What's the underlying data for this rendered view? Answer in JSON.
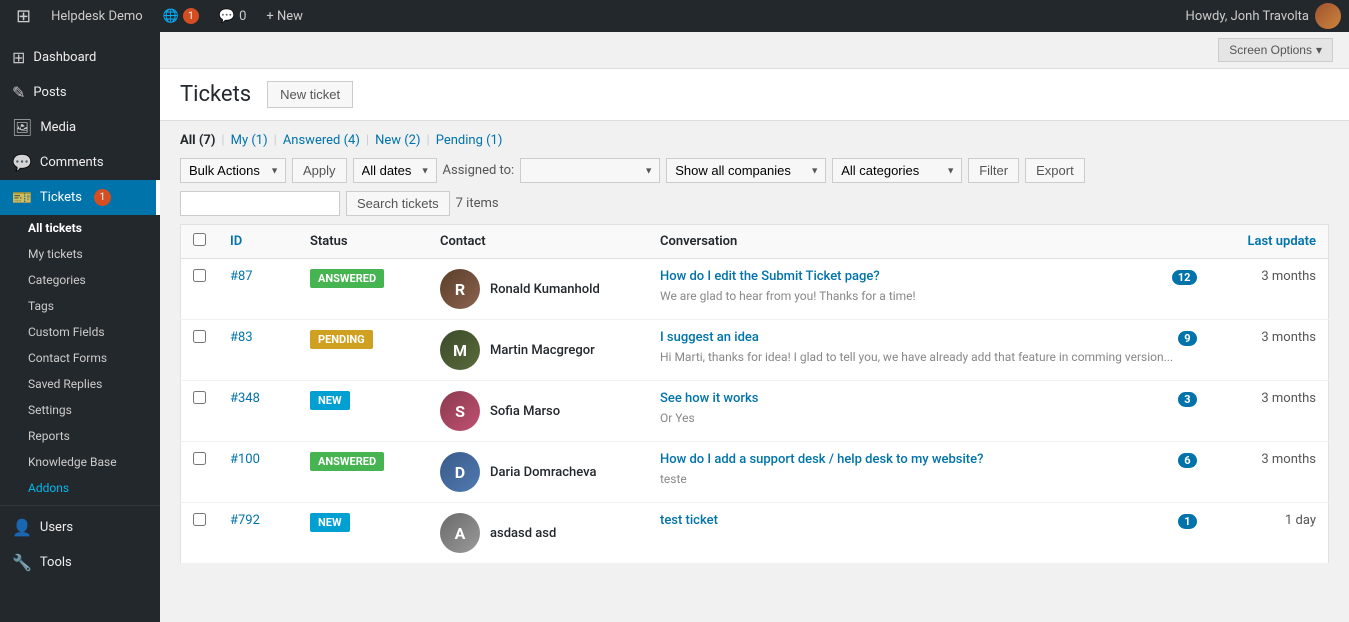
{
  "adminbar": {
    "site_name": "Helpdesk Demo",
    "globe_count": "1",
    "comment_count": "0",
    "new_label": "+ New",
    "user_name": "Howdy, Jonh Travolta",
    "screen_options": "Screen Options"
  },
  "sidebar": {
    "items": [
      {
        "id": "dashboard",
        "label": "Dashboard",
        "icon": "⊞"
      },
      {
        "id": "posts",
        "label": "Posts",
        "icon": "✎"
      },
      {
        "id": "media",
        "label": "Media",
        "icon": "🖼"
      },
      {
        "id": "comments",
        "label": "Comments",
        "icon": "💬"
      },
      {
        "id": "tickets",
        "label": "Tickets",
        "icon": "🎫",
        "badge": "1",
        "active": true
      }
    ],
    "tickets_sub": [
      {
        "id": "all-tickets",
        "label": "All tickets",
        "active": true
      },
      {
        "id": "my-tickets",
        "label": "My tickets"
      },
      {
        "id": "categories",
        "label": "Categories"
      },
      {
        "id": "tags",
        "label": "Tags"
      },
      {
        "id": "custom-fields",
        "label": "Custom Fields"
      },
      {
        "id": "contact-forms",
        "label": "Contact Forms"
      },
      {
        "id": "saved-replies",
        "label": "Saved Replies"
      },
      {
        "id": "settings",
        "label": "Settings"
      },
      {
        "id": "reports",
        "label": "Reports"
      },
      {
        "id": "knowledge-base",
        "label": "Knowledge Base"
      },
      {
        "id": "addons",
        "label": "Addons"
      }
    ],
    "bottom_items": [
      {
        "id": "users",
        "label": "Users",
        "icon": "👤"
      },
      {
        "id": "tools",
        "label": "Tools",
        "icon": "🔧"
      }
    ]
  },
  "page": {
    "title": "Tickets",
    "new_ticket_label": "New ticket"
  },
  "filter_tabs": [
    {
      "id": "all",
      "label": "All",
      "count": "7",
      "active": true
    },
    {
      "id": "my",
      "label": "My",
      "count": "1"
    },
    {
      "id": "answered",
      "label": "Answered",
      "count": "4"
    },
    {
      "id": "new",
      "label": "New",
      "count": "2"
    },
    {
      "id": "pending",
      "label": "Pending",
      "count": "1"
    }
  ],
  "toolbar": {
    "bulk_actions_label": "Bulk Actions",
    "apply_label": "Apply",
    "all_dates_label": "All dates",
    "assigned_to_label": "Assigned to:",
    "assigned_placeholder": "",
    "show_all_companies_label": "Show all companies",
    "all_categories_label": "All categories",
    "filter_label": "Filter",
    "export_label": "Export",
    "items_count": "7 items",
    "search_placeholder": "",
    "search_btn": "Search tickets"
  },
  "table": {
    "headers": {
      "id": "ID",
      "status": "Status",
      "contact": "Contact",
      "conversation": "Conversation",
      "last_update": "Last update"
    },
    "rows": [
      {
        "id": "#87",
        "status": "ANSWERED",
        "status_type": "answered",
        "contact_name": "Ronald Kumanhold",
        "contact_avatar": "av-ronald",
        "conv_title": "How do I edit the Submit Ticket page?",
        "conv_count": "12",
        "conv_preview": "We are glad to hear from you! Thanks for a time!",
        "last_update": "3 months"
      },
      {
        "id": "#83",
        "status": "PENDING",
        "status_type": "pending",
        "contact_name": "Martin Macgregor",
        "contact_avatar": "av-martin",
        "conv_title": "I suggest an idea",
        "conv_count": "9",
        "conv_preview": "Hi Marti, thanks for idea! I glad to tell you, we have already add that feature in comming version...",
        "last_update": "3 months"
      },
      {
        "id": "#348",
        "status": "NEW",
        "status_type": "new",
        "contact_name": "Sofia Marso",
        "contact_avatar": "av-sofia",
        "conv_title": "See how it works",
        "conv_count": "3",
        "conv_preview": "Or Yes",
        "last_update": "3 months"
      },
      {
        "id": "#100",
        "status": "ANSWERED",
        "status_type": "answered",
        "contact_name": "Daria Domracheva",
        "contact_avatar": "av-daria",
        "conv_title": "How do I add a support desk / help desk to my website?",
        "conv_count": "6",
        "conv_preview": "teste",
        "last_update": "3 months"
      },
      {
        "id": "#792",
        "status": "NEW",
        "status_type": "new",
        "contact_name": "asdasd asd",
        "contact_avatar": "av-asdasd",
        "conv_title": "test ticket",
        "conv_count": "1",
        "conv_preview": "",
        "last_update": "1 day"
      }
    ]
  }
}
